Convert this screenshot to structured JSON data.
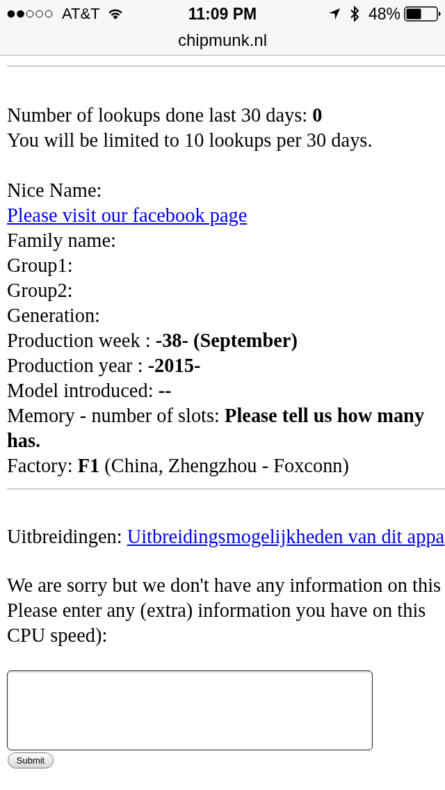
{
  "status_bar": {
    "carrier": "AT&T",
    "time": "11:09 PM",
    "battery": "48%"
  },
  "address_bar": {
    "url": "chipmunk.nl"
  },
  "lookup_info": [
    "Number of lookups done last 30 days: **0**",
    "You will be limited to 10 lookups per 30 days."
  ],
  "details": [
    {
      "kind": "text",
      "text": "Nice Name:"
    },
    {
      "kind": "link",
      "text": "Please visit our facebook page"
    },
    {
      "kind": "text",
      "text": "Family name:"
    },
    {
      "kind": "text",
      "text": "Group1:"
    },
    {
      "kind": "text",
      "text": "Group2:"
    },
    {
      "kind": "text",
      "text": "Generation:"
    },
    {
      "kind": "text",
      "text": "Production week : **-38- (September)**"
    },
    {
      "kind": "text",
      "text": "Production year : **-2015-**"
    },
    {
      "kind": "text",
      "text": "Model introduced: **--**"
    },
    {
      "kind": "text",
      "text": "Memory - number of slots: **Please tell us how many**"
    },
    {
      "kind": "bold",
      "text": "has."
    },
    {
      "kind": "text",
      "text": "Factory: **F1** (China, Zhengzhou - Foxconn)"
    }
  ],
  "extensions": {
    "label": "Uitbreidingen:",
    "link": "Uitbreidingsmogelijkheden van dit appa"
  },
  "notice": [
    "We are sorry but we don't have any information on this",
    "Please enter any (extra) information you have on this",
    "CPU speed):"
  ],
  "form": {
    "submit": "Submit"
  }
}
